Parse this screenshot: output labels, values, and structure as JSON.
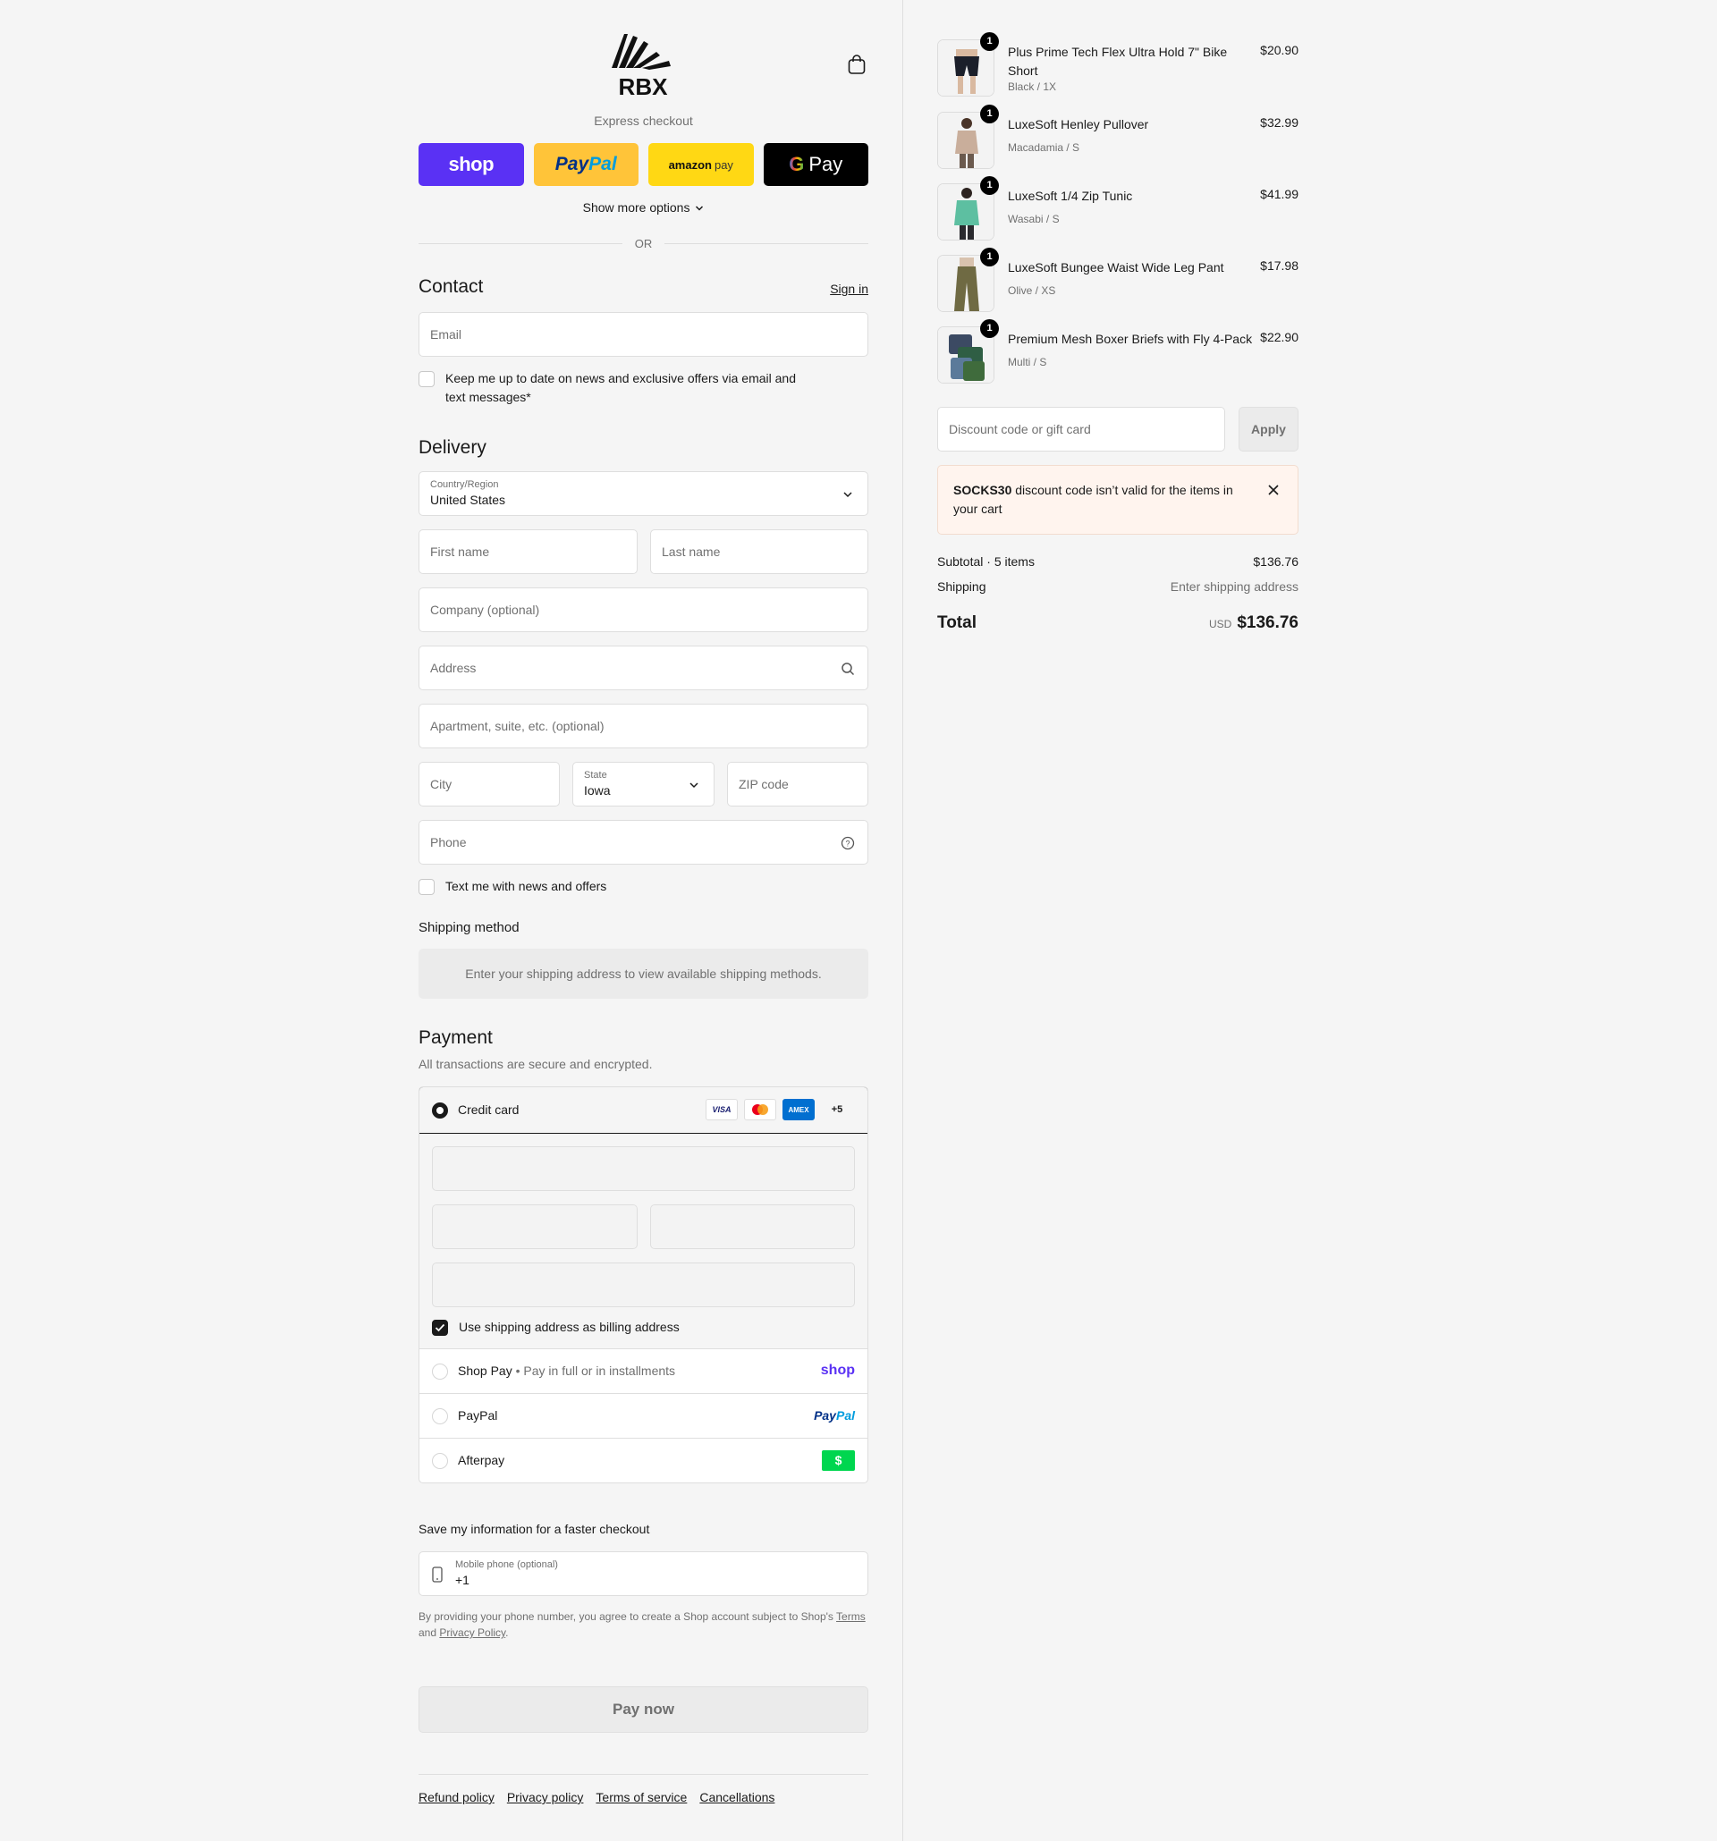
{
  "brand": {
    "logo_text": "RBX"
  },
  "express": {
    "label": "Express checkout",
    "shop": "shop",
    "paypal_a": "Pay",
    "paypal_b": "Pal",
    "amazon_a": "amazon",
    "amazon_b": "pay",
    "gpay_g": "G",
    "gpay_text": "Pay",
    "more_options": "Show more options",
    "or": "OR"
  },
  "contact": {
    "heading": "Contact",
    "sign_in": "Sign in",
    "email_placeholder": "Email",
    "news_optin": "Keep me up to date on news and exclusive offers via email and text messages*"
  },
  "delivery": {
    "heading": "Delivery",
    "country_label": "Country/Region",
    "country_value": "United States",
    "first_name": "First name",
    "last_name": "Last name",
    "company": "Company (optional)",
    "address": "Address",
    "apartment": "Apartment, suite, etc. (optional)",
    "city": "City",
    "state_label": "State",
    "state_value": "Iowa",
    "zip": "ZIP code",
    "phone": "Phone",
    "text_optin": "Text me with news and offers"
  },
  "shipping_method": {
    "heading": "Shipping method",
    "note": "Enter your shipping address to view available shipping methods."
  },
  "payment": {
    "heading": "Payment",
    "subtitle": "All transactions are secure and encrypted.",
    "credit_card": "Credit card",
    "cards": [
      "VISA",
      "",
      "AMEX",
      "+5"
    ],
    "billing_same": "Use shipping address as billing address",
    "shop_pay": "Shop Pay",
    "shop_pay_sub": "Pay in full or in installments",
    "shop_logo": "shop",
    "paypal": "PayPal",
    "paypal_logo_a": "Pay",
    "paypal_logo_b": "Pal",
    "afterpay": "Afterpay",
    "afterpay_logo": "$"
  },
  "save_info": {
    "heading": "Save my information for a faster checkout",
    "mobile_label": "Mobile phone (optional)",
    "mobile_value": "+1",
    "disclaimer_a": "By providing your phone number, you agree to create a Shop account subject to Shop's ",
    "terms": "Terms",
    "disclaimer_b": "and ",
    "privacy": "Privacy Policy",
    "disclaimer_end": "."
  },
  "pay_now": "Pay now",
  "footer": [
    "Refund policy",
    "Privacy policy",
    "Terms of service",
    "Cancellations"
  ],
  "cart": {
    "items": [
      {
        "name": "Plus Prime Tech Flex Ultra Hold 7\" Bike Short",
        "variant": "Black / 1X",
        "price": "$20.90",
        "qty": "1"
      },
      {
        "name": "LuxeSoft Henley Pullover",
        "variant": "Macadamia / S",
        "price": "$32.99",
        "qty": "1"
      },
      {
        "name": "LuxeSoft 1/4 Zip Tunic",
        "variant": "Wasabi / S",
        "price": "$41.99",
        "qty": "1"
      },
      {
        "name": "LuxeSoft Bungee Waist Wide Leg Pant",
        "variant": "Olive / XS",
        "price": "$17.98",
        "qty": "1"
      },
      {
        "name": "Premium Mesh Boxer Briefs with Fly 4-Pack",
        "variant": "Multi / S",
        "price": "$22.90",
        "qty": "1"
      }
    ],
    "discount_placeholder": "Discount code or gift card",
    "apply": "Apply",
    "alert_code": "SOCKS30",
    "alert_msg": " discount code isn’t valid for the items in your cart",
    "subtotal_label": "Subtotal · 5 items",
    "subtotal_value": "$136.76",
    "shipping_label": "Shipping",
    "shipping_value": "Enter shipping address",
    "total_label": "Total",
    "currency": "USD",
    "total_value": "$136.76"
  }
}
